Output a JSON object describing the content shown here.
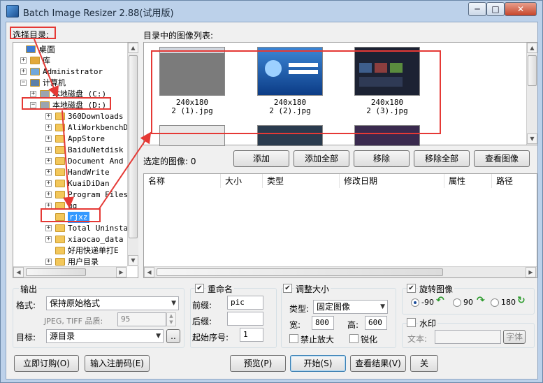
{
  "window": {
    "title": "Batch Image Resizer 2.88(试用版)",
    "min": "─",
    "max": "□",
    "close": "✕"
  },
  "left": {
    "select_dir_label": "选择目录:",
    "tree": [
      {
        "label": "桌面"
      },
      {
        "label": "库"
      },
      {
        "label": "Administrator"
      },
      {
        "label": "计算机"
      },
      {
        "label": "本地磁盘 (C:)"
      },
      {
        "label": "本地磁盘 (D:)"
      },
      {
        "label": "360Downloads"
      },
      {
        "label": "AliWorkbenchD"
      },
      {
        "label": "AppStore"
      },
      {
        "label": "BaiduNetdisk"
      },
      {
        "label": "Document And"
      },
      {
        "label": "HandWrite"
      },
      {
        "label": "KuaiDiDan"
      },
      {
        "label": "Program Files"
      },
      {
        "label": "qq"
      },
      {
        "label": "rjxz"
      },
      {
        "label": "Total Uninsta"
      },
      {
        "label": "xiaocao_data"
      },
      {
        "label": "好用快递单打E"
      },
      {
        "label": "用户目录"
      }
    ]
  },
  "images": {
    "list_label": "目录中的图像列表:",
    "thumbs": [
      {
        "size": "240x180",
        "name": "2 (1).jpg"
      },
      {
        "size": "240x180",
        "name": "2 (2).jpg"
      },
      {
        "size": "240x180",
        "name": "2 (3).jpg"
      }
    ],
    "selected_label": "选定的图像:",
    "selected_count": "0",
    "buttons": {
      "add": "添加",
      "add_all": "添加全部",
      "remove": "移除",
      "remove_all": "移除全部",
      "view": "查看图像"
    },
    "columns": [
      "名称",
      "大小",
      "类型",
      "修改日期",
      "属性",
      "路径"
    ]
  },
  "output": {
    "title": "输出",
    "format_label": "格式:",
    "format_value": "保持原始格式",
    "quality_label": "JPEG, TIFF 品质:",
    "quality_value": "95",
    "target_label": "目标:",
    "target_value": "源目录",
    "browse": ".."
  },
  "rename": {
    "title": "重命名",
    "prefix_label": "前缀:",
    "prefix_value": "pic",
    "suffix_label": "后缀:",
    "suffix_value": "",
    "start_label": "起始序号:",
    "start_value": "1"
  },
  "resize": {
    "title": "调整大小",
    "type_label": "类型:",
    "type_value": "固定图像",
    "width_label": "宽:",
    "width_value": "800",
    "height_label": "高:",
    "height_value": "600",
    "no_enlarge": "禁止放大",
    "sharpen": "锐化"
  },
  "rotate": {
    "title": "旋转图像",
    "opt1": "-90",
    "opt2": "90",
    "opt3": "180"
  },
  "watermark": {
    "title": "水印",
    "text_label": "文本:",
    "font_button": "字体"
  },
  "bottom": {
    "subscribe": "立即订购(O)",
    "register": "输入注册码(E)",
    "preview": "预览(P)",
    "start": "开始(S)",
    "results": "查看结果(V)",
    "exit": "关"
  }
}
